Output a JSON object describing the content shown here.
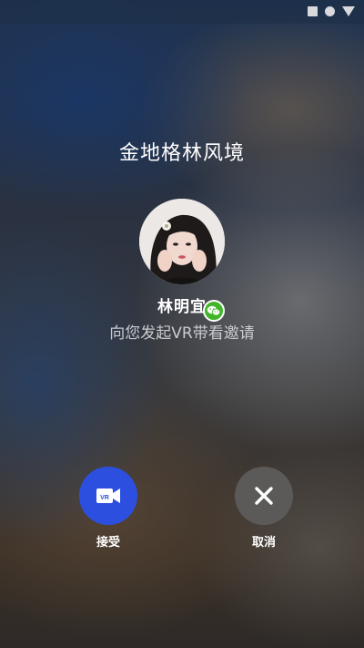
{
  "status_bar": {
    "icons": [
      "square-icon",
      "circle-icon",
      "triangle-icon"
    ]
  },
  "call": {
    "title": "金地格林风境",
    "caller_name": "林明宜",
    "caller_badge_icon": "wechat-icon",
    "message": "向您发起VR带看邀请"
  },
  "actions": {
    "accept": {
      "label": "接受",
      "icon": "vr-camera-icon",
      "color": "#2d4fe0"
    },
    "cancel": {
      "label": "取消",
      "icon": "close-icon",
      "color": "#5c5a58"
    }
  }
}
